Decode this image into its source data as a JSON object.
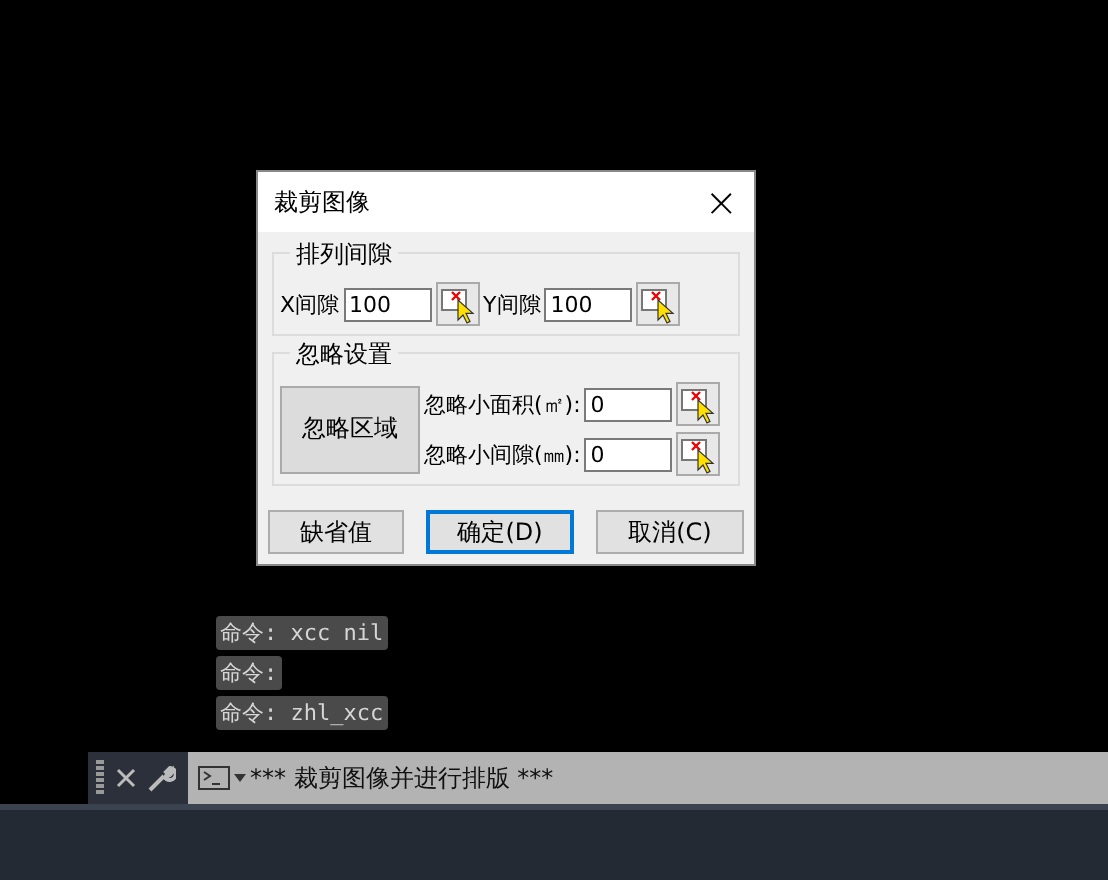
{
  "dialog": {
    "title": "裁剪图像",
    "close": "×",
    "spacing_group": {
      "title": "排列间隙",
      "fields": [
        {
          "label": "X间隙",
          "value": "100"
        },
        {
          "label": "Y间隙",
          "value": "100"
        }
      ]
    },
    "ignore_group": {
      "title": "忽略设置",
      "region_button": "忽略区域",
      "fields": [
        {
          "label": "忽略小面积(㎡):",
          "value": "0"
        },
        {
          "label": "忽略小间隙(㎜):",
          "value": "0"
        }
      ]
    },
    "buttons": [
      {
        "label": "缺省值",
        "selected": false
      },
      {
        "label": "确定(D)",
        "selected": true
      },
      {
        "label": "取消(C)",
        "selected": false
      }
    ]
  },
  "history": [
    "命令: xcc nil",
    "命令:",
    "命令: zhl_xcc"
  ],
  "command_line": {
    "text": "*** 裁剪图像并进行排版 ***"
  }
}
